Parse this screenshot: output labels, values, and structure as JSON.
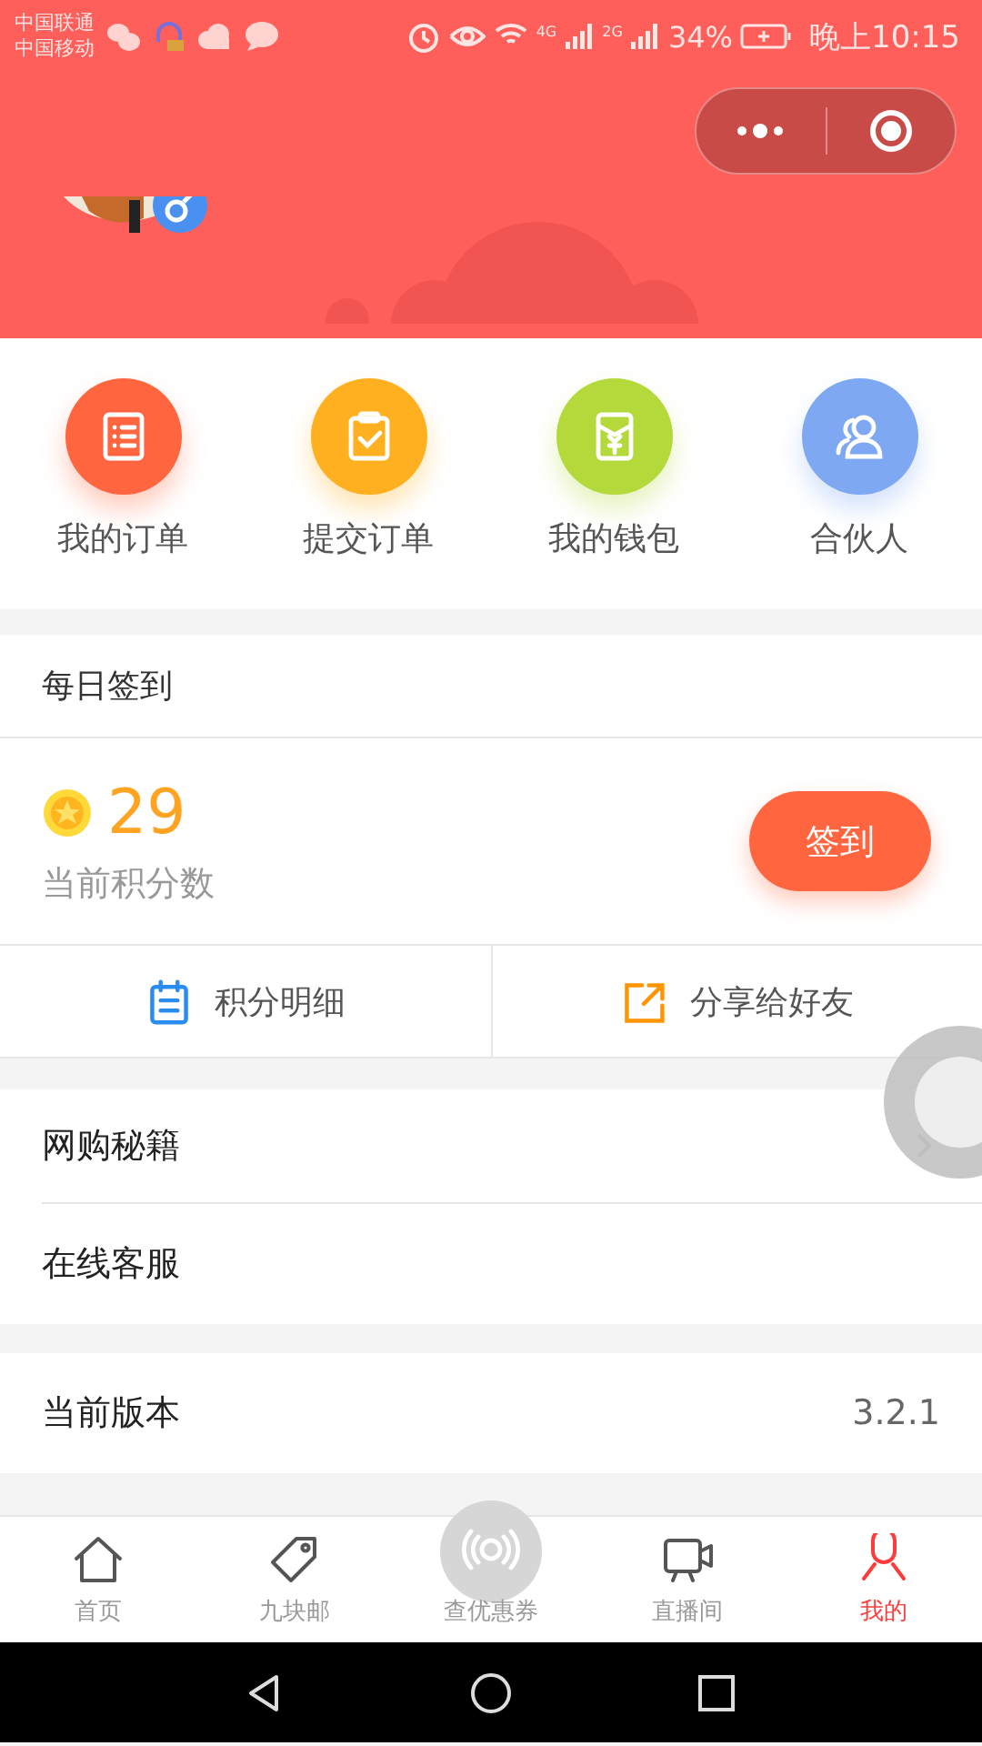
{
  "status_bar": {
    "carriers": [
      "中国联通",
      "中国移动"
    ],
    "network_labels": [
      "4G",
      "2G"
    ],
    "battery": "34%",
    "time": "晚上10:15"
  },
  "shortcuts": [
    {
      "label": "我的订单",
      "color": "#ff6640"
    },
    {
      "label": "提交订单",
      "color": "#ffb020"
    },
    {
      "label": "我的钱包",
      "color": "#b3d93a"
    },
    {
      "label": "合伙人",
      "color": "#7ea8f2"
    }
  ],
  "checkin": {
    "title": "每日签到",
    "points": "29",
    "points_label": "当前积分数",
    "button": "签到",
    "actions": [
      {
        "label": "积分明细"
      },
      {
        "label": "分享给好友"
      }
    ]
  },
  "menu": [
    {
      "label": "网购秘籍",
      "chevron": true
    },
    {
      "label": "在线客服",
      "chevron": false
    }
  ],
  "version": {
    "label": "当前版本",
    "value": "3.2.1"
  },
  "tab_bar": [
    {
      "label": "首页",
      "selected": false
    },
    {
      "label": "九块邮",
      "selected": false
    },
    {
      "label": "查优惠券",
      "selected": false
    },
    {
      "label": "直播间",
      "selected": false
    },
    {
      "label": "我的",
      "selected": true
    }
  ]
}
